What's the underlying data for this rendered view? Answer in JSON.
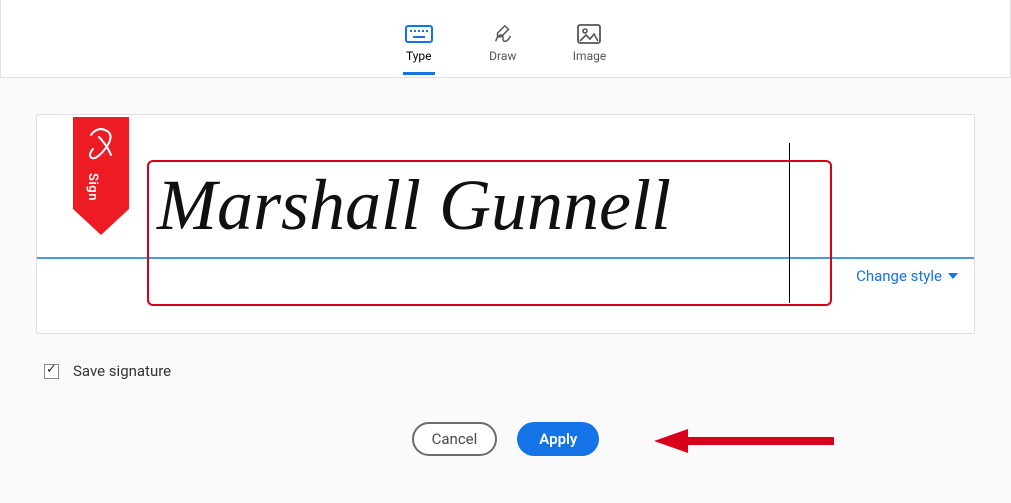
{
  "toolbar": {
    "tabs": [
      {
        "label": "Type",
        "active": true
      },
      {
        "label": "Draw",
        "active": false
      },
      {
        "label": "Image",
        "active": false
      }
    ]
  },
  "signature": {
    "ribbon_label": "Sign",
    "typed_name": "Marshall Gunnell",
    "change_style_label": "Change style"
  },
  "save": {
    "checked": true,
    "label": "Save signature"
  },
  "buttons": {
    "cancel": "Cancel",
    "apply": "Apply"
  },
  "colors": {
    "accent": "#1473e6",
    "ribbon": "#ed1c24",
    "annotation": "#d9001b"
  }
}
